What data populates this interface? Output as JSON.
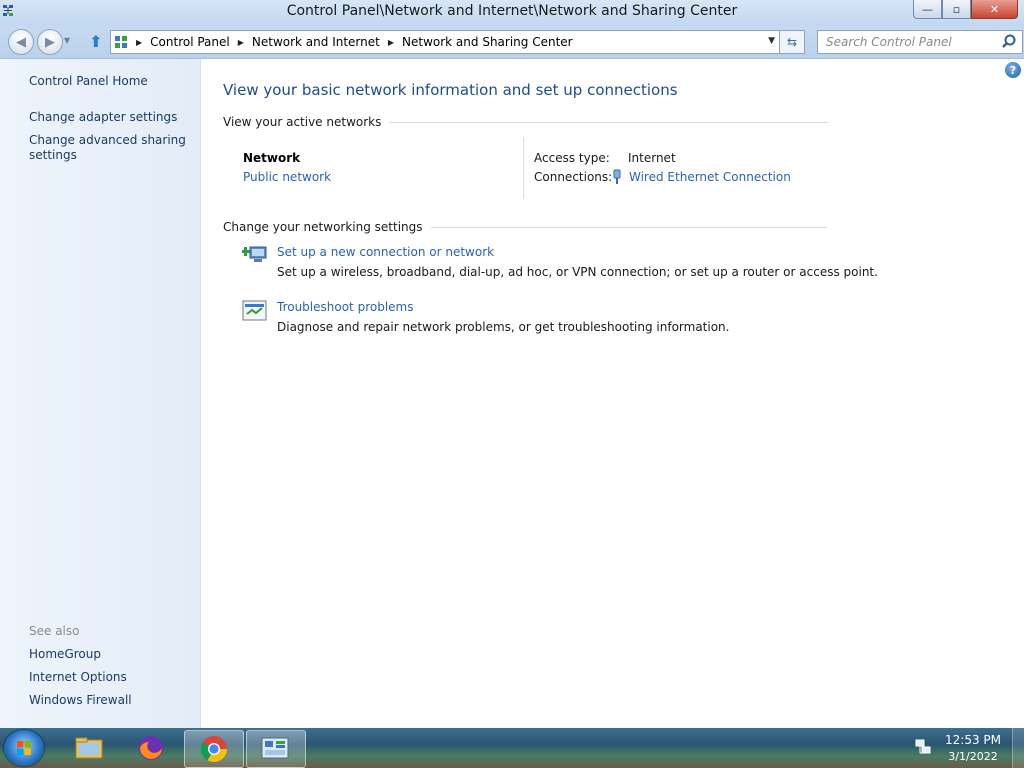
{
  "window": {
    "title": "Control Panel\\Network and Internet\\Network and Sharing Center",
    "minimize": "—",
    "maximize": "▫",
    "close": "✕"
  },
  "address_bar": {
    "breadcrumbs": [
      "Control Panel",
      "Network and Internet",
      "Network and Sharing Center"
    ],
    "search_placeholder": "Search Control Panel"
  },
  "left_pane": {
    "links": [
      "Control Panel Home",
      "Change adapter settings",
      "Change advanced sharing settings"
    ],
    "see_also_label": "See also",
    "see_also_links": [
      "HomeGroup",
      "Internet Options",
      "Windows Firewall"
    ]
  },
  "main": {
    "title": "View your basic network information and set up connections",
    "active_networks_header": "View your active networks",
    "network": {
      "name": "Network",
      "type": "Public network",
      "access_type_label": "Access type:",
      "access_type_value": "Internet",
      "connections_label": "Connections:",
      "connection_name": "Wired Ethernet Connection"
    },
    "settings_header": "Change your networking settings",
    "tasks": [
      {
        "title": "Set up a new connection or network",
        "description": "Set up a wireless, broadband, dial-up, ad hoc, or VPN connection; or set up a router or access point."
      },
      {
        "title": "Troubleshoot problems",
        "description": "Diagnose and repair network problems, or get troubleshooting information."
      }
    ]
  },
  "taskbar": {
    "clock_time": "12:53 PM",
    "clock_date": "3/1/2022",
    "pinned": [
      "file-explorer-icon",
      "firefox-icon",
      "chrome-icon",
      "control-panel-icon"
    ]
  },
  "colors": {
    "link": "#2a64b0",
    "title": "#1e4b8f",
    "left_pane_link": "#1e3a66"
  }
}
